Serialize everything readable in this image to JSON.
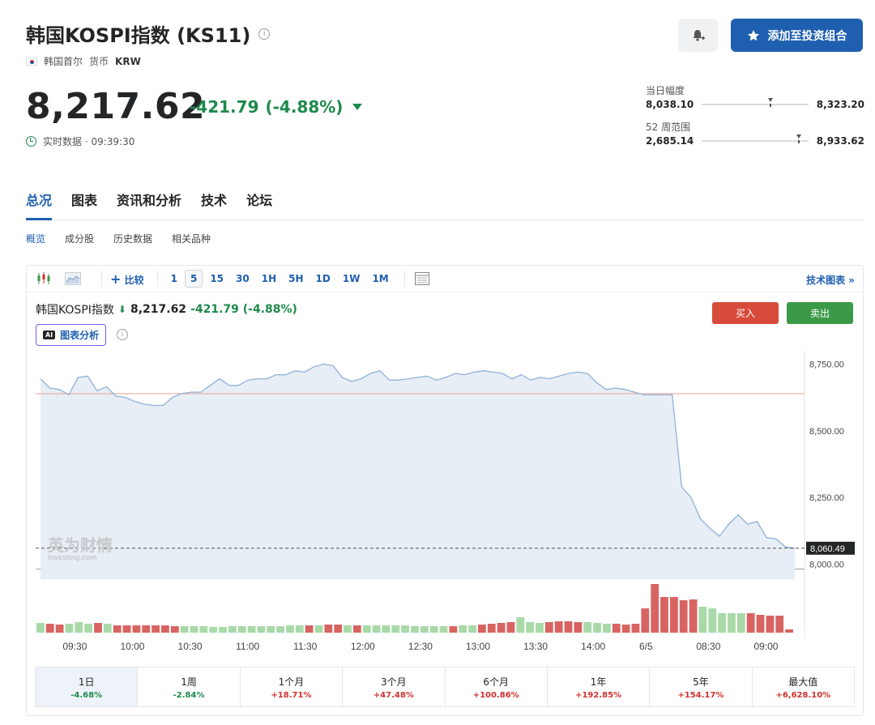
{
  "header": {
    "title": "韩国KOSPI指数 (KS11)",
    "country": "韩国首尔",
    "currency_label": "货币",
    "currency": "KRW",
    "add_portfolio_label": "添加至投资组合"
  },
  "quote": {
    "price": "8,217.62",
    "change": "-421.79",
    "change_pct": "(-4.88%)",
    "realtime": "实时数据 · 09:39:30"
  },
  "ranges": {
    "day": {
      "label": "当日幅度",
      "low": "8,038.10",
      "high": "8,323.20",
      "position": 0.62
    },
    "week52": {
      "label": "52 周范围",
      "low": "2,685.14",
      "high": "8,933.62",
      "position": 0.885
    }
  },
  "tabs": [
    "总况",
    "图表",
    "资讯和分析",
    "技术",
    "论坛"
  ],
  "subtabs": [
    "概览",
    "成分股",
    "历史数据",
    "相关品种"
  ],
  "toolbar": {
    "compare": "比较",
    "timeframes": [
      "1",
      "5",
      "15",
      "30",
      "1H",
      "5H",
      "1D",
      "1W",
      "1M"
    ],
    "active_timeframe": "5",
    "tech_chart": "技术图表 »"
  },
  "instrument": {
    "name": "韩国KOSPI指数",
    "price": "8,217.62",
    "change": "-421.79 (-4.88%)",
    "ai_badge": "AI",
    "ai_label": "图表分析",
    "buy": "买入",
    "sell": "卖出"
  },
  "watermark": {
    "cn": "英为财情",
    "en": "Investing.com"
  },
  "colors": {
    "accent": "#1f5faf",
    "down": "#1e8a4c",
    "up": "#d0312d",
    "line": "#8fb2d8",
    "fill": "#e8eef6",
    "prev_close": "#e8a08f",
    "vol_up": "#d86462",
    "vol_down": "#a9d9a9"
  },
  "chart_data": {
    "type": "area",
    "ylim": [
      7950,
      8800
    ],
    "yticks": [
      "8,750.00",
      "8,500.00",
      "8,250.00",
      "8,000.00"
    ],
    "ytick_values": [
      8750,
      8500,
      8250,
      8000
    ],
    "xticks": [
      "09:30",
      "10:00",
      "10:30",
      "11:00",
      "11:30",
      "12:00",
      "12:30",
      "13:00",
      "13:30",
      "14:00",
      "6/5",
      "08:30",
      "09:00"
    ],
    "xtick_positions": [
      4,
      10,
      16,
      22,
      28,
      34,
      40,
      46,
      52,
      58,
      63.5,
      70,
      76
    ],
    "prev_close": 8639,
    "last_label": "8,060.49",
    "last_value": 8060,
    "series": [
      {
        "values": [
          8695,
          8660,
          8655,
          8635,
          8700,
          8705,
          8650,
          8665,
          8630,
          8625,
          8610,
          8600,
          8595,
          8595,
          8625,
          8640,
          8645,
          8645,
          8670,
          8695,
          8670,
          8670,
          8690,
          8695,
          8695,
          8710,
          8710,
          8725,
          8720,
          8740,
          8750,
          8745,
          8700,
          8685,
          8695,
          8715,
          8725,
          8690,
          8690,
          8695,
          8700,
          8705,
          8690,
          8700,
          8715,
          8710,
          8720,
          8725,
          8720,
          8715,
          8695,
          8710,
          8690,
          8700,
          8695,
          8705,
          8715,
          8720,
          8715,
          8680,
          8655,
          8660,
          8655,
          8645,
          8635,
          8635,
          8635,
          8635,
          8290,
          8250,
          8170,
          8135,
          8105,
          8150,
          8185,
          8150,
          8160,
          8100,
          8095,
          8065,
          8060
        ]
      }
    ],
    "volume": {
      "values": [
        12,
        11,
        10,
        11,
        13,
        11,
        12,
        11,
        9,
        9,
        9,
        9,
        9,
        9,
        8,
        8,
        8,
        8,
        7,
        7,
        8,
        8,
        8,
        8,
        8,
        8,
        9,
        9,
        9,
        9,
        10,
        10,
        9,
        9,
        9,
        9,
        9,
        9,
        9,
        8,
        8,
        8,
        8,
        8,
        9,
        9,
        10,
        11,
        12,
        13,
        19,
        13,
        12,
        13,
        14,
        14,
        13,
        13,
        12,
        11,
        11,
        10,
        11,
        30,
        60,
        44,
        44,
        40,
        41,
        32,
        30,
        24,
        24,
        24,
        24,
        22,
        21,
        21,
        4
      ],
      "up": [
        0,
        1,
        1,
        0,
        0,
        0,
        1,
        0,
        1,
        1,
        1,
        1,
        1,
        1,
        1,
        0,
        0,
        0,
        0,
        0,
        0,
        0,
        0,
        0,
        0,
        0,
        0,
        0,
        1,
        0,
        1,
        1,
        0,
        1,
        0,
        0,
        0,
        0,
        0,
        0,
        0,
        0,
        0,
        1,
        0,
        0,
        1,
        1,
        1,
        1,
        0,
        0,
        0,
        1,
        1,
        1,
        1,
        0,
        0,
        0,
        1,
        1,
        1,
        1,
        1,
        1,
        1,
        1,
        1,
        0,
        0,
        0,
        0,
        0,
        1,
        1,
        1,
        1,
        1,
        1,
        0
      ]
    }
  },
  "periods": [
    {
      "label": "1日",
      "value": "-4.68%",
      "dir": "neg"
    },
    {
      "label": "1周",
      "value": "-2.84%",
      "dir": "neg"
    },
    {
      "label": "1个月",
      "value": "+18.71%",
      "dir": "pos"
    },
    {
      "label": "3个月",
      "value": "+47.48%",
      "dir": "pos"
    },
    {
      "label": "6个月",
      "value": "+100.86%",
      "dir": "pos"
    },
    {
      "label": "1年",
      "value": "+192.85%",
      "dir": "pos"
    },
    {
      "label": "5年",
      "value": "+154.17%",
      "dir": "pos"
    },
    {
      "label": "最大值",
      "value": "+6,628.10%",
      "dir": "pos"
    }
  ]
}
